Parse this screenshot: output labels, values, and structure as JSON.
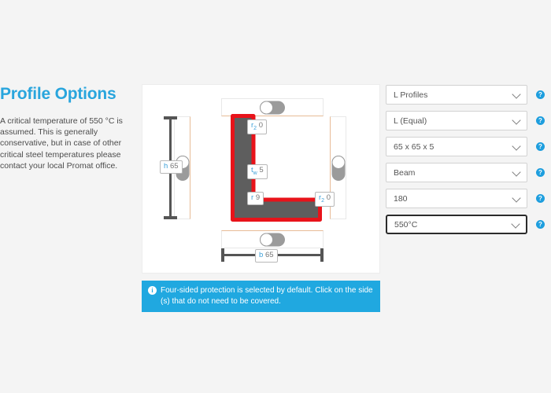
{
  "left": {
    "title": "Profile Options",
    "description": "A critical temperature of 550 °C is assumed. This is generally conservative, but in case of other critical steel temperatures please contact your local Promat office.",
    "title_color": "#29a5dd"
  },
  "diagram": {
    "profile_type": "L-angle",
    "protection_color": "#e8131a",
    "steel_color": "#5e5e5e",
    "toggles": [
      {
        "name": "top",
        "state": "on"
      },
      {
        "name": "left",
        "state": "on"
      },
      {
        "name": "right",
        "state": "on"
      },
      {
        "name": "bottom",
        "state": "on"
      }
    ],
    "dimensions": {
      "height": {
        "symbol": "h",
        "value": "65"
      },
      "width": {
        "symbol": "b",
        "value": "65"
      }
    },
    "labels": {
      "r2_top": {
        "symbol": "r",
        "sub": "2",
        "value": "0"
      },
      "tw": {
        "symbol": "t",
        "sub": "w",
        "value": "5"
      },
      "r": {
        "symbol": "r",
        "sub": "",
        "value": "9"
      },
      "r2_bottom": {
        "symbol": "r",
        "sub": "2",
        "value": "0"
      }
    }
  },
  "info": {
    "icon": "info-icon",
    "text": "Four-sided protection is selected by default. Click on the side (s) that do not need to be covered.",
    "background": "#20a8e0"
  },
  "controls": {
    "help_glyph": "?",
    "rows": [
      {
        "name": "profile-family",
        "value": "L Profiles"
      },
      {
        "name": "profile-subtype",
        "value": "L (Equal)"
      },
      {
        "name": "profile-size",
        "value": "65 x 65 x 5"
      },
      {
        "name": "element-type",
        "value": "Beam"
      },
      {
        "name": "fire-rating",
        "value": "180"
      },
      {
        "name": "critical-temperature",
        "value": "550°C",
        "focused": true
      }
    ]
  }
}
